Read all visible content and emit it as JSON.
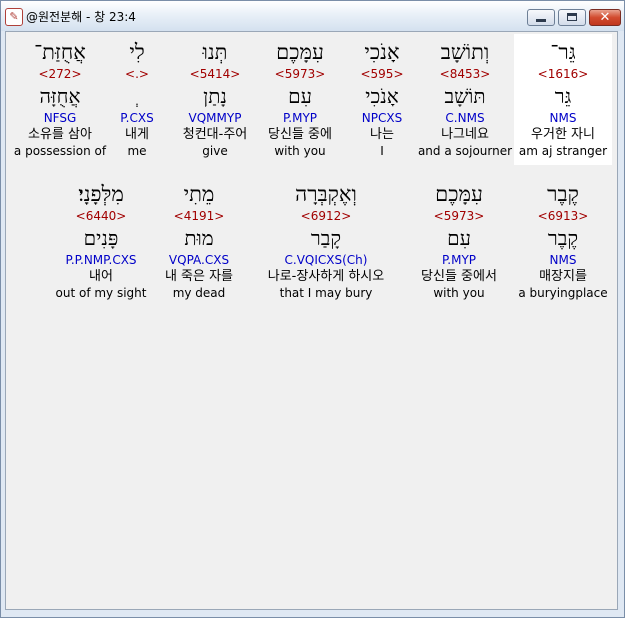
{
  "window": {
    "title": "@원전분해 - 창 23:4",
    "icon": "app-logo-icon",
    "close_glyph": "✕"
  },
  "lines": [
    [
      {
        "hebrew": "גֵּר־",
        "strong": "<1616>",
        "lemma": "גֵּר",
        "morph": "NMS",
        "korean": "우거한 자니",
        "english": "am aj stranger",
        "highlight": true
      },
      {
        "hebrew": "וְתוֹשָׁב",
        "strong": "<8453>",
        "lemma": "תּוֹשָׁב",
        "morph": "C.NMS",
        "korean": "나그네요",
        "english": "and a sojourner",
        "highlight": false
      },
      {
        "hebrew": "אָנֹכִי",
        "strong": "<595>",
        "lemma": "אָנֹכִי",
        "morph": "NPCXS",
        "korean": "나는",
        "english": "I",
        "highlight": false
      },
      {
        "hebrew": "עִמָּכֶם",
        "strong": "<5973>",
        "lemma": "עִם",
        "morph": "P.MYP",
        "korean": "당신들 중에",
        "english": "with you",
        "highlight": false
      },
      {
        "hebrew": "תְּנוּ",
        "strong": "<5414>",
        "lemma": "נָתַן",
        "morph": "VQMMYP",
        "korean": "청컨대-주어",
        "english": "give",
        "highlight": false
      },
      {
        "hebrew": "לִי",
        "strong": "<.>",
        "lemma": "ְ",
        "morph": "P.CXS",
        "korean": "내게",
        "english": "me",
        "highlight": false
      },
      {
        "hebrew": "אֲחֻזַּת־",
        "strong": "<272>",
        "lemma": "אֲחֻזָּה",
        "morph": "NFSG",
        "korean": "소유를 삼아",
        "english": "a possession of",
        "highlight": false
      }
    ],
    [
      {
        "hebrew": "קֶבֶר",
        "strong": "<6913>",
        "lemma": "קֶבֶר",
        "morph": "NMS",
        "korean": "매장지를",
        "english": "a buryingplace",
        "highlight": false
      },
      {
        "hebrew": "עִמָּכֶם",
        "strong": "<5973>",
        "lemma": "עִם",
        "morph": "P.MYP",
        "korean": "당신들 중에서",
        "english": "with you",
        "highlight": false
      },
      {
        "hebrew": "וְאֶקְבְּרָה",
        "strong": "<6912>",
        "lemma": "קָבַר",
        "morph": "C.VQICXS(Ch)",
        "korean": "나로-장사하게 하시오",
        "english": "that I may bury",
        "highlight": false
      },
      {
        "hebrew": "מֵתִי",
        "strong": "<4191>",
        "lemma": "מוּת",
        "morph": "VQPA.CXS",
        "korean": "내 죽은 자를",
        "english": "my dead",
        "highlight": false
      },
      {
        "hebrew": "מִלְּפָנָי׃",
        "strong": "<6440>",
        "lemma": "פָּנִים",
        "morph": "P.P.NMP.CXS",
        "korean": "내어",
        "english": "out of my sight",
        "highlight": false
      }
    ]
  ]
}
